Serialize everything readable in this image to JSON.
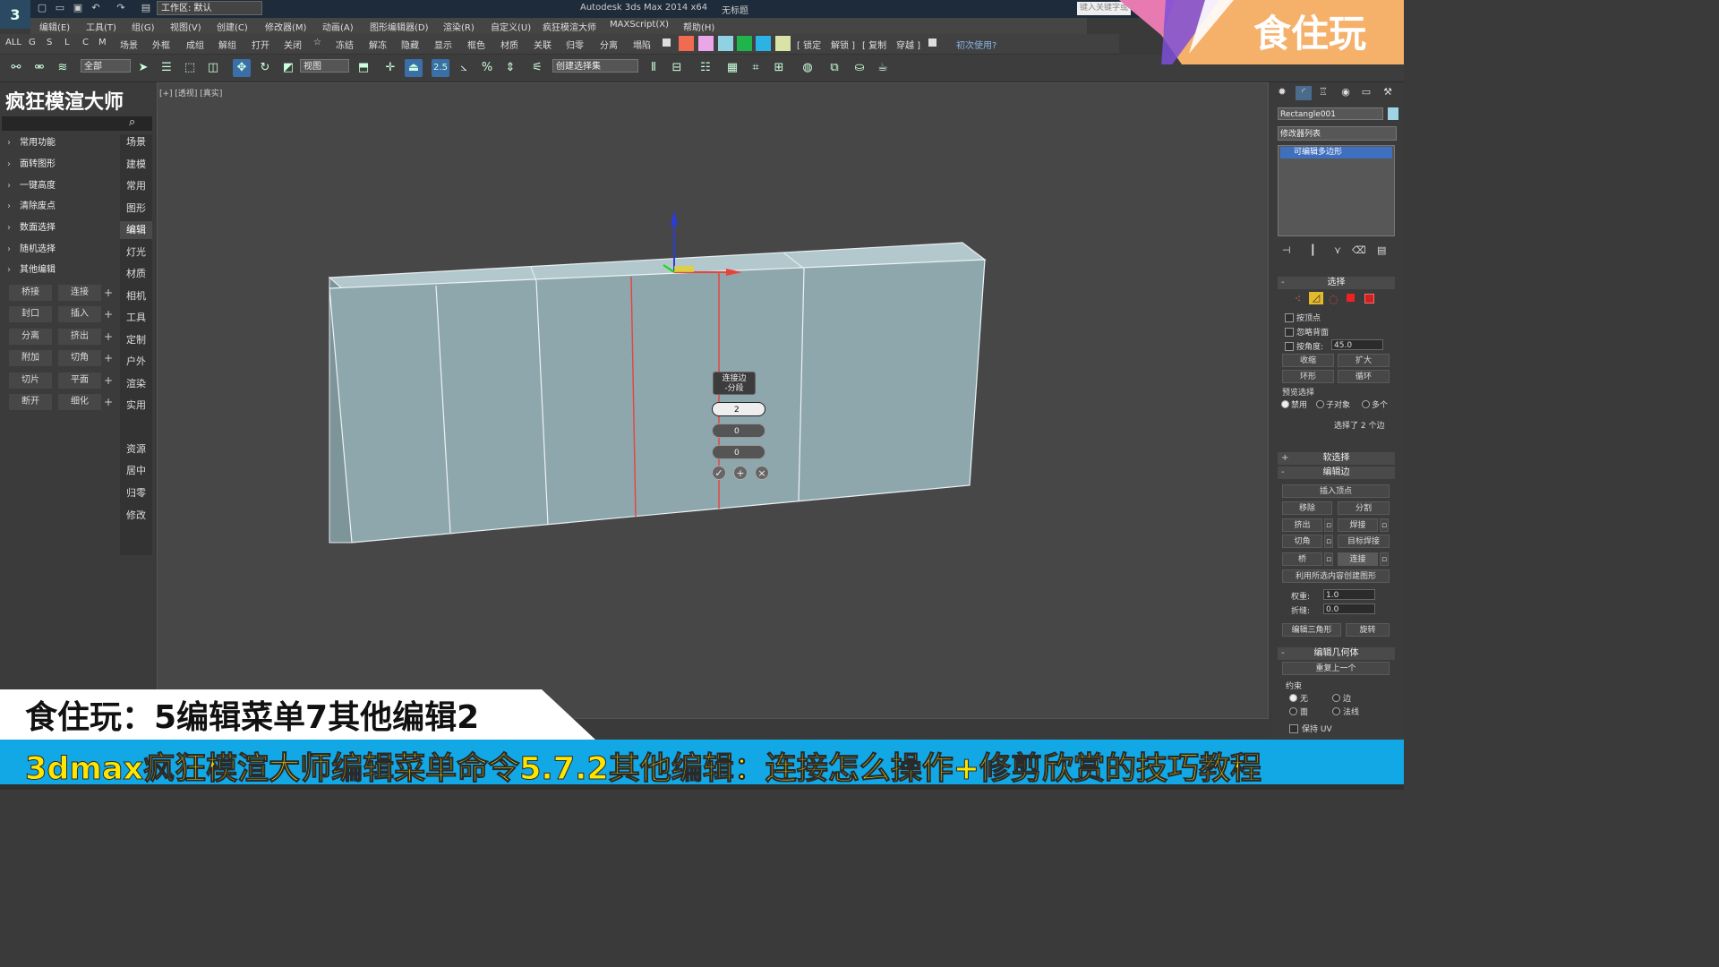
{
  "titlebar": {
    "workspace": "工作区: 默认",
    "app_title": "Autodesk 3ds Max 2014 x64",
    "doc_title": "无标题",
    "search_placeholder": "键入关键字或"
  },
  "menu": [
    "编辑(E)",
    "工具(T)",
    "组(G)",
    "视图(V)",
    "创建(C)",
    "修改器(M)",
    "动画(A)",
    "图形编辑器(D)",
    "渲染(R)",
    "自定义(U)",
    "疯狂模渲大师",
    "MAXScript(X)",
    "帮助(H)"
  ],
  "toolbar1": {
    "filters": [
      "ALL",
      "G",
      "S",
      "L",
      "C",
      "M"
    ],
    "items_a": [
      "场景",
      "外框",
      "成组",
      "解组",
      "打开",
      "关闭",
      "☆",
      "冻结",
      "解冻",
      "隐藏",
      "显示",
      "框色",
      "材质",
      "关联",
      "归零",
      "分离",
      "塌陷"
    ],
    "swatch_colors": [
      "#f26a4f",
      "#e9a6e9",
      "#8fd3e3",
      "#1fb54a",
      "#2bb3e6",
      "#d9e3a5"
    ],
    "items_b": [
      "[ 锁定",
      "解锁 ]",
      "[ 复制",
      "穿越 ]"
    ],
    "help": "初次使用?"
  },
  "toolbar2": {
    "filter_select": "全部",
    "view_select": "视图",
    "snap_value": "2.5",
    "named_selection": "创建选择集"
  },
  "plugin": {
    "title": "疯狂模渲大师",
    "categories": [
      "常用功能",
      "面转图形",
      "一键高度",
      "清除废点",
      "数面选择",
      "随机选择",
      "其他编辑"
    ],
    "side_tabs": [
      "场景",
      "建模",
      "常用",
      "图形",
      "编辑",
      "灯光",
      "材质",
      "相机",
      "工具",
      "定制",
      "户外",
      "渲染",
      "实用"
    ],
    "side_tabs_2": [
      "资源",
      "居中",
      "归零",
      "修改"
    ],
    "buttons": [
      [
        "桥接",
        "连接"
      ],
      [
        "封口",
        "插入"
      ],
      [
        "分离",
        "挤出"
      ],
      [
        "附加",
        "切角"
      ],
      [
        "切片",
        "平面"
      ],
      [
        "断开",
        "细化"
      ]
    ]
  },
  "viewport": {
    "label": "[+] [透视] [真实]",
    "caddy_title_1": "连接边",
    "caddy_title_2": "-分段",
    "segments": "2",
    "pinch": "0",
    "slide": "0"
  },
  "command_panel": {
    "object_name": "Rectangle001",
    "modifier_list": "修改器列表",
    "stack_item": "可编辑多边形",
    "selection_rollout": "选择",
    "by_vertex": "按顶点",
    "ignore_backfacing": "忽略背面",
    "by_angle": "按角度:",
    "angle_value": "45.0",
    "shrink": "收缩",
    "grow": "扩大",
    "ring": "环形",
    "loop": "循环",
    "preview_selection": "预览选择",
    "preview_options": [
      "禁用",
      "子对象",
      "多个"
    ],
    "selected_info": "选择了 2 个边",
    "soft_selection": "软选择",
    "edit_edges": "编辑边",
    "insert_vertex": "插入顶点",
    "remove": "移除",
    "split": "分割",
    "extrude": "挤出",
    "weld": "焊接",
    "chamfer": "切角",
    "target_weld": "目标焊接",
    "bridge": "桥",
    "connect": "连接",
    "create_shape": "利用所选内容创建图形",
    "weight_label": "权重:",
    "weight_value": "1.0",
    "crease_label": "折缝:",
    "crease_value": "0.0",
    "edit_triangulation": "编辑三角形",
    "turn": "旋转",
    "edit_geometry": "编辑几何体",
    "repeat_last": "重复上一个",
    "constraints": "约束",
    "constraint_options": [
      "无",
      "边",
      "面",
      "法线"
    ],
    "preserve_uv": "保持 UV"
  },
  "overlay": {
    "brand": "食住玩",
    "caption_top": "食住玩：5编辑菜单7其他编辑2",
    "caption_bottom": "3dmax疯狂模渲大师编辑菜单命令5.7.2其他编辑：连接怎么操作+修剪欣赏的技巧教程"
  },
  "colors": {
    "box_face": "#8da7ad",
    "edge_selected": "#e8433b",
    "caption_bar": "#12a8e6",
    "caption_text": "#ffe600",
    "brand_banner": "#f5b06a"
  }
}
